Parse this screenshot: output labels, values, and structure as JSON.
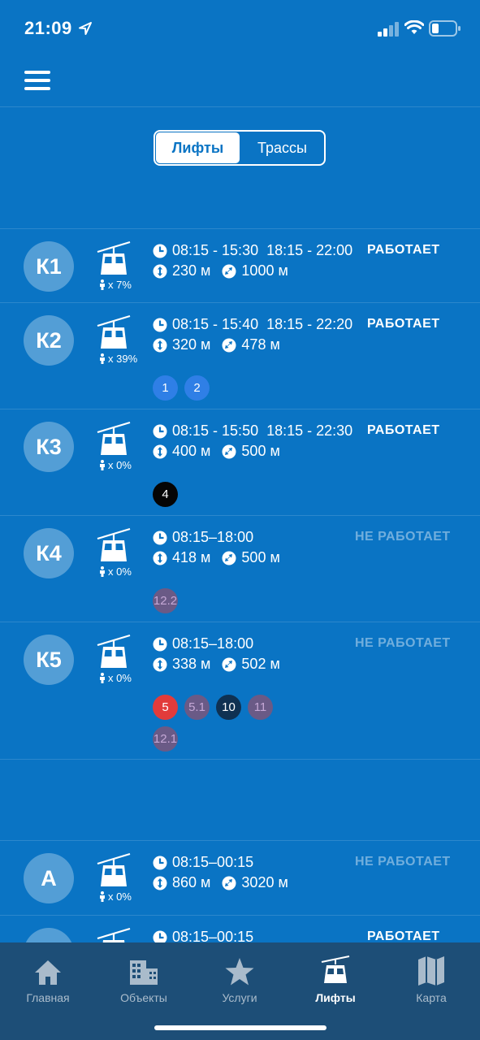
{
  "status_bar": {
    "time": "21:09"
  },
  "segments": {
    "lifts": "Лифты",
    "trails": "Трассы"
  },
  "lifts": [
    {
      "name": "К1",
      "occupancy": "x 7%",
      "hours": "08:15 - 15:30  18:15 - 22:00",
      "height": "230 м",
      "length": "1000 м",
      "status": "РАБОТАЕТ",
      "status_kind": "on",
      "trails": []
    },
    {
      "name": "К2",
      "occupancy": "x 39%",
      "hours": "08:15 - 15:40  18:15 - 22:20",
      "height": "320 м",
      "length": "478 м",
      "status": "РАБОТАЕТ",
      "status_kind": "on",
      "trails": [
        {
          "label": "1",
          "color": "#2f7fe6"
        },
        {
          "label": "2",
          "color": "#2f7fe6"
        }
      ]
    },
    {
      "name": "К3",
      "occupancy": "x 0%",
      "hours": "08:15 - 15:50  18:15 - 22:30",
      "height": "400 м",
      "length": "500 м",
      "status": "РАБОТАЕТ",
      "status_kind": "on",
      "trails": [
        {
          "label": "4",
          "color": "#050505"
        }
      ]
    },
    {
      "name": "К4",
      "occupancy": "x 0%",
      "hours": "08:15–18:00",
      "height": "418 м",
      "length": "500 м",
      "status": "НЕ РАБОТАЕТ",
      "status_kind": "off",
      "trails": [
        {
          "label": "12.2",
          "color": "#6a5a86"
        }
      ]
    },
    {
      "name": "К5",
      "occupancy": "x 0%",
      "hours": "08:15–18:00",
      "height": "338 м",
      "length": "502 м",
      "status": "НЕ РАБОТАЕТ",
      "status_kind": "off",
      "trails": [
        {
          "label": "5",
          "color": "#e23b3b"
        },
        {
          "label": "5.1",
          "color": "#6a5a86"
        },
        {
          "label": "10",
          "color": "#0f3152"
        },
        {
          "label": "11",
          "color": "#6a5a86"
        },
        {
          "label": "12.1",
          "color": "#6a5a86"
        }
      ]
    },
    {
      "name": "А",
      "occupancy": "x 0%",
      "hours": "08:15–00:15",
      "height": "860 м",
      "length": "3020 м",
      "status": "НЕ РАБОТАЕТ",
      "status_kind": "off",
      "trails": []
    },
    {
      "name": "",
      "occupancy": "",
      "hours": "08:15–00:15",
      "height": "",
      "length": "",
      "status": "РАБОТАЕТ",
      "status_kind": "on",
      "trails": []
    }
  ],
  "tabbar": [
    {
      "label": "Главная",
      "icon": "home-icon",
      "active": false
    },
    {
      "label": "Объекты",
      "icon": "building-icon",
      "active": false
    },
    {
      "label": "Услуги",
      "icon": "star-icon",
      "active": false
    },
    {
      "label": "Лифты",
      "icon": "gondola-icon",
      "active": true
    },
    {
      "label": "Карта",
      "icon": "map-icon",
      "active": false
    }
  ]
}
